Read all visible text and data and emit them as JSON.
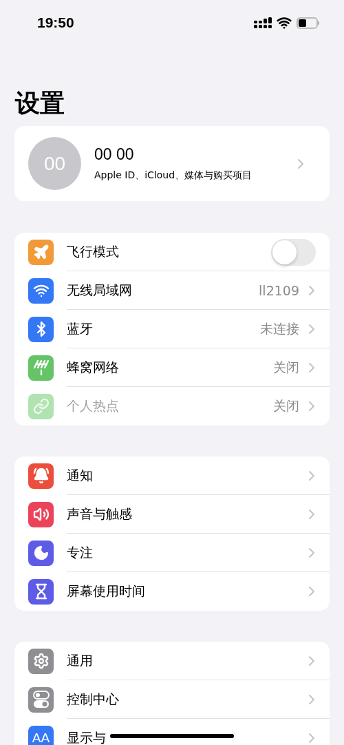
{
  "status_bar": {
    "time": "19:50"
  },
  "title": "设置",
  "profile": {
    "avatar_initials": "00",
    "name": "00 00",
    "subtitle": "Apple ID、iCloud、媒体与购买项目"
  },
  "groups": [
    {
      "rows": [
        {
          "kind": "toggle",
          "label": "飞行模式",
          "color": "#f19a37",
          "on": false,
          "disabled": false
        },
        {
          "kind": "link",
          "label": "无线局域网",
          "value": "ll2109",
          "color": "#3478f6",
          "disabled": false
        },
        {
          "kind": "link",
          "label": "蓝牙",
          "value": "未连接",
          "color": "#3478f6",
          "disabled": false
        },
        {
          "kind": "link",
          "label": "蜂窝网络",
          "value": "关闭",
          "color": "#65c466",
          "disabled": false
        },
        {
          "kind": "link",
          "label": "个人热点",
          "value": "关闭",
          "color": "#b1e2b2",
          "disabled": true
        }
      ]
    },
    {
      "rows": [
        {
          "kind": "link",
          "label": "通知",
          "color": "#eb4e3d",
          "disabled": false
        },
        {
          "kind": "link",
          "label": "声音与触感",
          "color": "#eb445a",
          "disabled": false
        },
        {
          "kind": "link",
          "label": "专注",
          "color": "#5e5ce6",
          "disabled": false
        },
        {
          "kind": "link",
          "label": "屏幕使用时间",
          "color": "#5e5ce6",
          "disabled": false
        }
      ]
    },
    {
      "rows": [
        {
          "kind": "link",
          "label": "通用",
          "color": "#8e8e93",
          "disabled": false
        },
        {
          "kind": "link",
          "label": "控制中心",
          "color": "#8e8e93",
          "disabled": false
        },
        {
          "kind": "link",
          "label": "显示与",
          "color": "#3478f6",
          "icon_text": "AA",
          "disabled": false
        }
      ]
    }
  ]
}
